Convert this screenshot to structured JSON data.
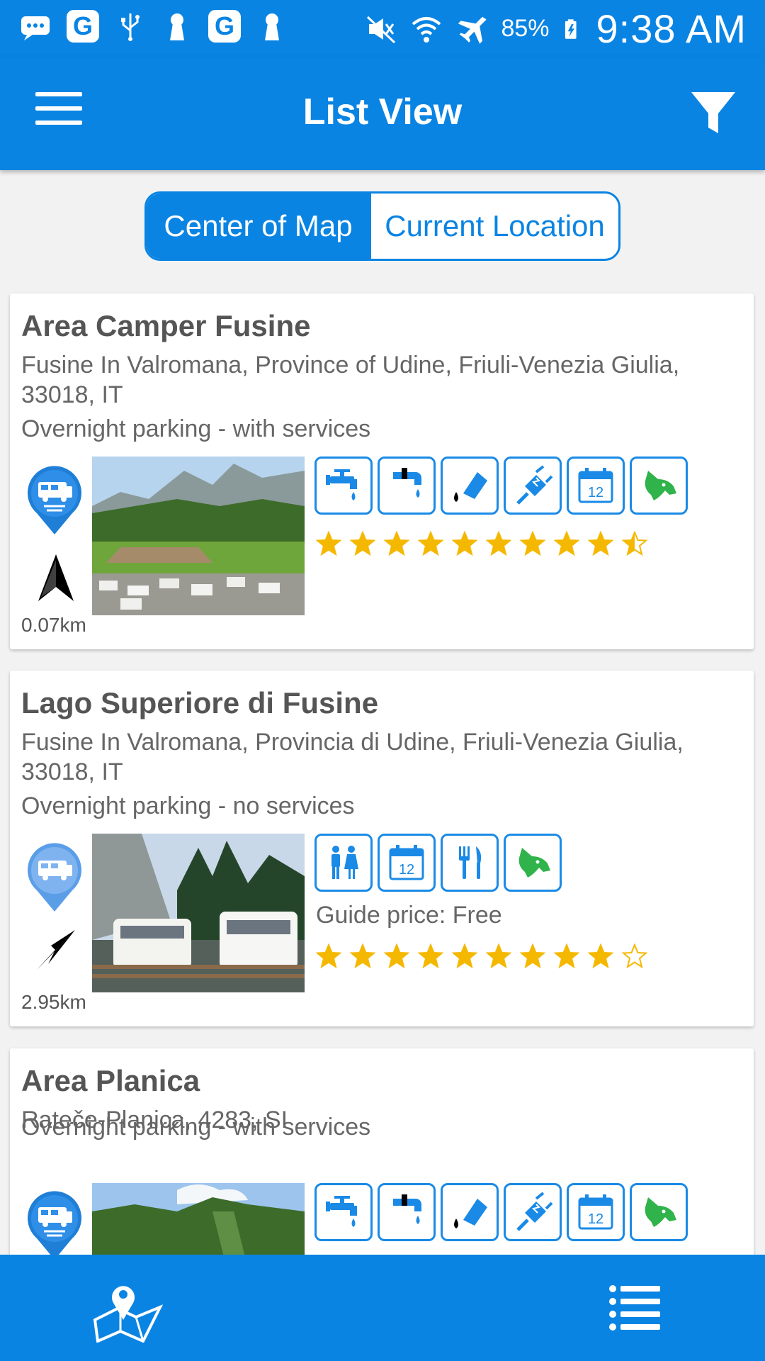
{
  "status_bar": {
    "battery": "85%",
    "time": "9:38 AM",
    "left_icons": [
      "message-icon",
      "google-icon",
      "usb-icon",
      "keyhole-icon",
      "google-icon",
      "keyhole-icon"
    ],
    "right_icons": [
      "mute-icon",
      "wifi-icon",
      "airplane-icon",
      "battery-charging-icon"
    ],
    "google_glyph": "G"
  },
  "app_bar": {
    "title": "List View",
    "menu_icon": "menu-icon",
    "filter_icon": "filter-icon"
  },
  "segment": {
    "active": "Center of Map",
    "inactive": "Current Location"
  },
  "places": [
    {
      "name": "Area Camper Fusine",
      "address": "Fusine In Valromana, Province of Udine, Friuli-Venezia Giulia, 33018, IT",
      "type": "Overnight parking - with services",
      "distance": "0.07km",
      "rating": 9.5,
      "amenities": [
        "water-tap-icon",
        "drain-icon",
        "dump-icon",
        "electricity-icon",
        "calendar-icon",
        "dog-icon"
      ]
    },
    {
      "name": "Lago Superiore di Fusine",
      "address": "Fusine In Valromana, Provincia di Udine, Friuli-Venezia Giulia, 33018, IT",
      "type": "Overnight parking - no services",
      "distance": "2.95km",
      "guide_price": "Guide price: Free",
      "rating": 9,
      "amenities": [
        "toilets-icon",
        "calendar-icon",
        "restaurant-icon",
        "dog-icon"
      ]
    },
    {
      "name": "Area Planica",
      "address": "Rateče-Planica, 4283, SI",
      "type": "Overnight parking - with services",
      "amenities": [
        "water-tap-icon",
        "drain-icon",
        "dump-icon",
        "electricity-icon",
        "calendar-icon",
        "dog-icon"
      ]
    }
  ],
  "calendar_day": "12",
  "bottom_bar": {
    "map_icon": "map-pin-icon",
    "list_icon": "list-icon"
  },
  "colors": {
    "primary": "#0a84e3",
    "star": "#f5b800",
    "dog": "#2fb34a"
  }
}
